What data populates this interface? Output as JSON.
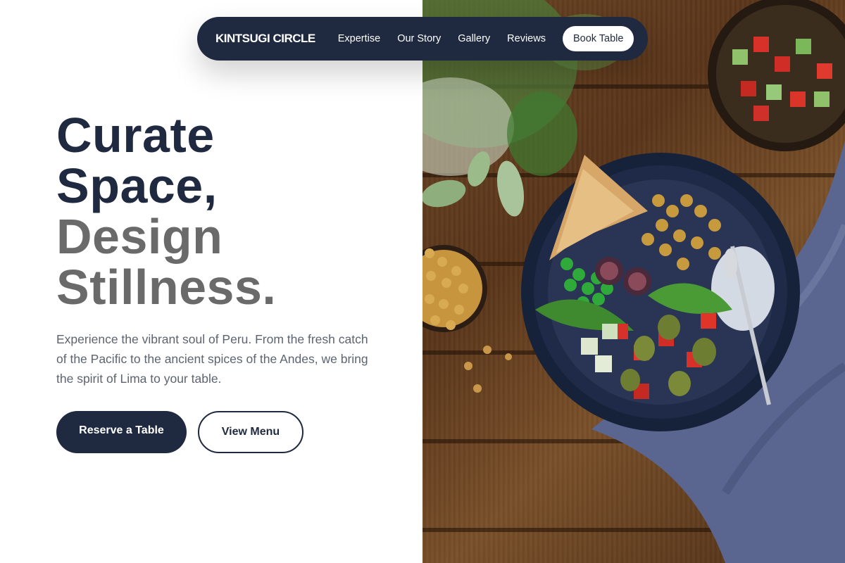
{
  "nav": {
    "brand": "KINTSUGI CIRCLE",
    "links": [
      "Expertise",
      "Our Story",
      "Gallery",
      "Reviews"
    ],
    "cta": "Book Table"
  },
  "hero": {
    "title_line1": "Curate",
    "title_line2": "Space,",
    "title_line3": "Design",
    "title_line4": "Stillness.",
    "description": "Experience the vibrant soul of Peru. From the fresh catch of the Pacific to the ancient spices of the Andes, we bring the spirit of Lima to your table.",
    "primary_button": "Reserve a Table",
    "secondary_button": "View Menu"
  },
  "colors": {
    "navy": "#1f2940",
    "gray_heading": "#6a6a6a",
    "body_text": "#5d6470"
  }
}
